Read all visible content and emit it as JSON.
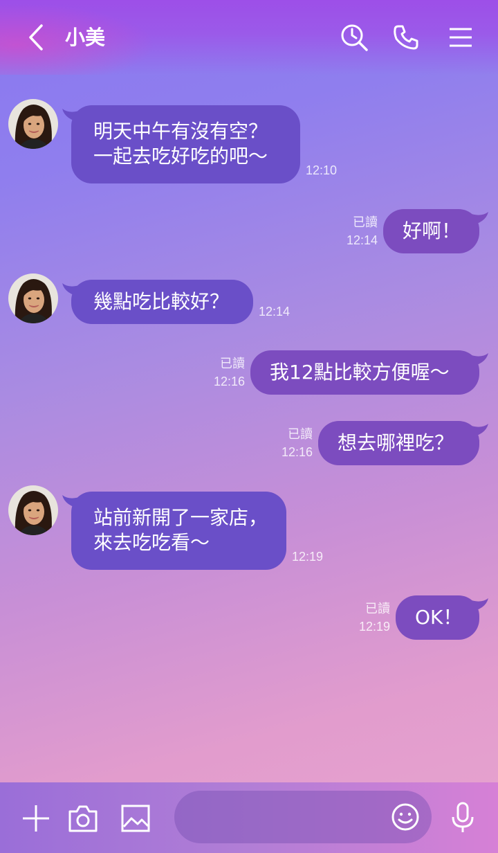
{
  "header": {
    "title": "小美",
    "icons": [
      "back-icon",
      "search-history-icon",
      "phone-icon",
      "menu-icon"
    ]
  },
  "messages": [
    {
      "side": "in",
      "lines": [
        "明天中午有沒有空？",
        "一起去吃好吃的吧～"
      ],
      "time": "12:10"
    },
    {
      "side": "out",
      "lines": [
        "好啊！"
      ],
      "read": "已讀",
      "time": "12:14"
    },
    {
      "side": "in",
      "lines": [
        "幾點吃比較好？"
      ],
      "time": "12:14"
    },
    {
      "side": "out",
      "lines": [
        "我12點比較方便喔～"
      ],
      "read": "已讀",
      "time": "12:16"
    },
    {
      "side": "out",
      "lines": [
        "想去哪裡吃？"
      ],
      "read": "已讀",
      "time": "12:16"
    },
    {
      "side": "in",
      "lines": [
        "站前新開了一家店，",
        "來去吃吃看～"
      ],
      "time": "12:19"
    },
    {
      "side": "out",
      "lines": [
        "OK！"
      ],
      "read": "已讀",
      "time": "12:19"
    }
  ],
  "composer": {
    "placeholder": "",
    "icons": [
      "add-icon",
      "camera-icon",
      "image-icon",
      "emoji-icon",
      "microphone-icon"
    ]
  },
  "colors": {
    "incoming_bubble": "#6a4fc8",
    "outgoing_bubble": "#7c4cbf",
    "text": "#ffffff"
  }
}
